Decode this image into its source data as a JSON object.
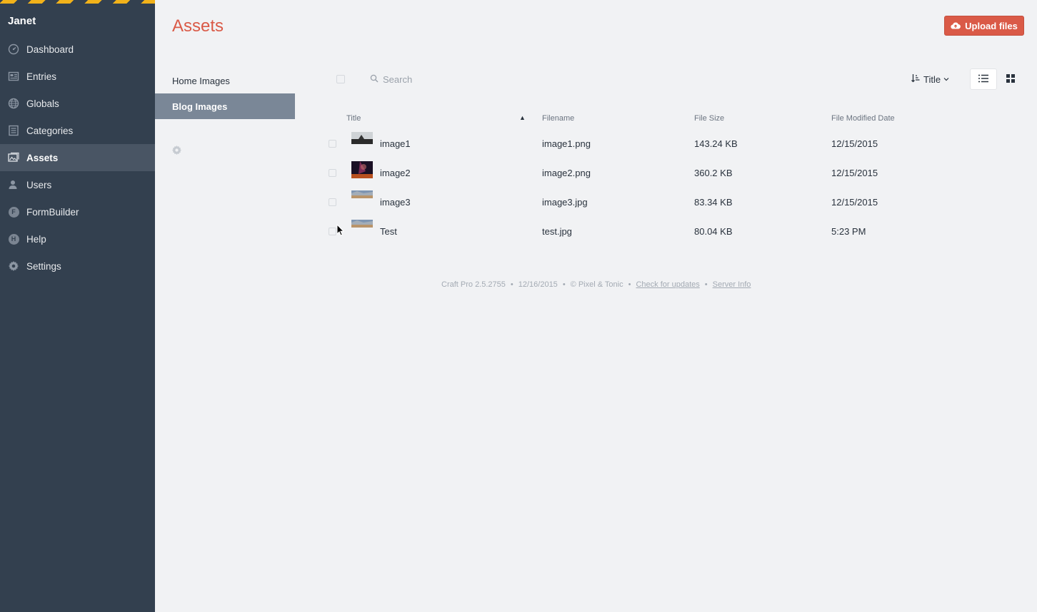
{
  "sidebar": {
    "site_name": "Janet",
    "items": [
      {
        "label": "Dashboard",
        "icon": "dashboard-icon"
      },
      {
        "label": "Entries",
        "icon": "entries-icon"
      },
      {
        "label": "Globals",
        "icon": "globe-icon"
      },
      {
        "label": "Categories",
        "icon": "categories-icon"
      },
      {
        "label": "Assets",
        "icon": "assets-icon",
        "active": true
      },
      {
        "label": "Users",
        "icon": "users-icon"
      },
      {
        "label": "FormBuilder",
        "icon": "formbuilder-icon",
        "letter": "F"
      },
      {
        "label": "Help",
        "icon": "help-icon",
        "letter": "H"
      },
      {
        "label": "Settings",
        "icon": "gear-icon"
      }
    ]
  },
  "header": {
    "title": "Assets",
    "upload_label": "Upload files"
  },
  "sources": {
    "items": [
      {
        "label": "Home Images"
      },
      {
        "label": "Blog Images",
        "active": true
      }
    ]
  },
  "toolbar": {
    "search_placeholder": "Search",
    "sort_label": "Title"
  },
  "table": {
    "columns": [
      "Title",
      "Filename",
      "File Size",
      "File Modified Date"
    ],
    "sort_indicator": "▲",
    "rows": [
      {
        "title": "image1",
        "filename": "image1.png",
        "size": "143.24 KB",
        "date": "12/15/2015"
      },
      {
        "title": "image2",
        "filename": "image2.png",
        "size": "360.2 KB",
        "date": "12/15/2015"
      },
      {
        "title": "image3",
        "filename": "image3.jpg",
        "size": "83.34 KB",
        "date": "12/15/2015"
      },
      {
        "title": "Test",
        "filename": "test.jpg",
        "size": "80.04 KB",
        "date": "5:23 PM"
      }
    ]
  },
  "footer": {
    "version": "Craft Pro 2.5.2755",
    "date": "12/16/2015",
    "copyright": "© Pixel & Tonic",
    "separator": "•",
    "check_updates": "Check for updates",
    "server_info": "Server Info"
  },
  "colors": {
    "sidebar_bg": "#33404f",
    "accent": "#da5a47",
    "active_source": "#7a8797",
    "stripe": "#f2b21a"
  }
}
